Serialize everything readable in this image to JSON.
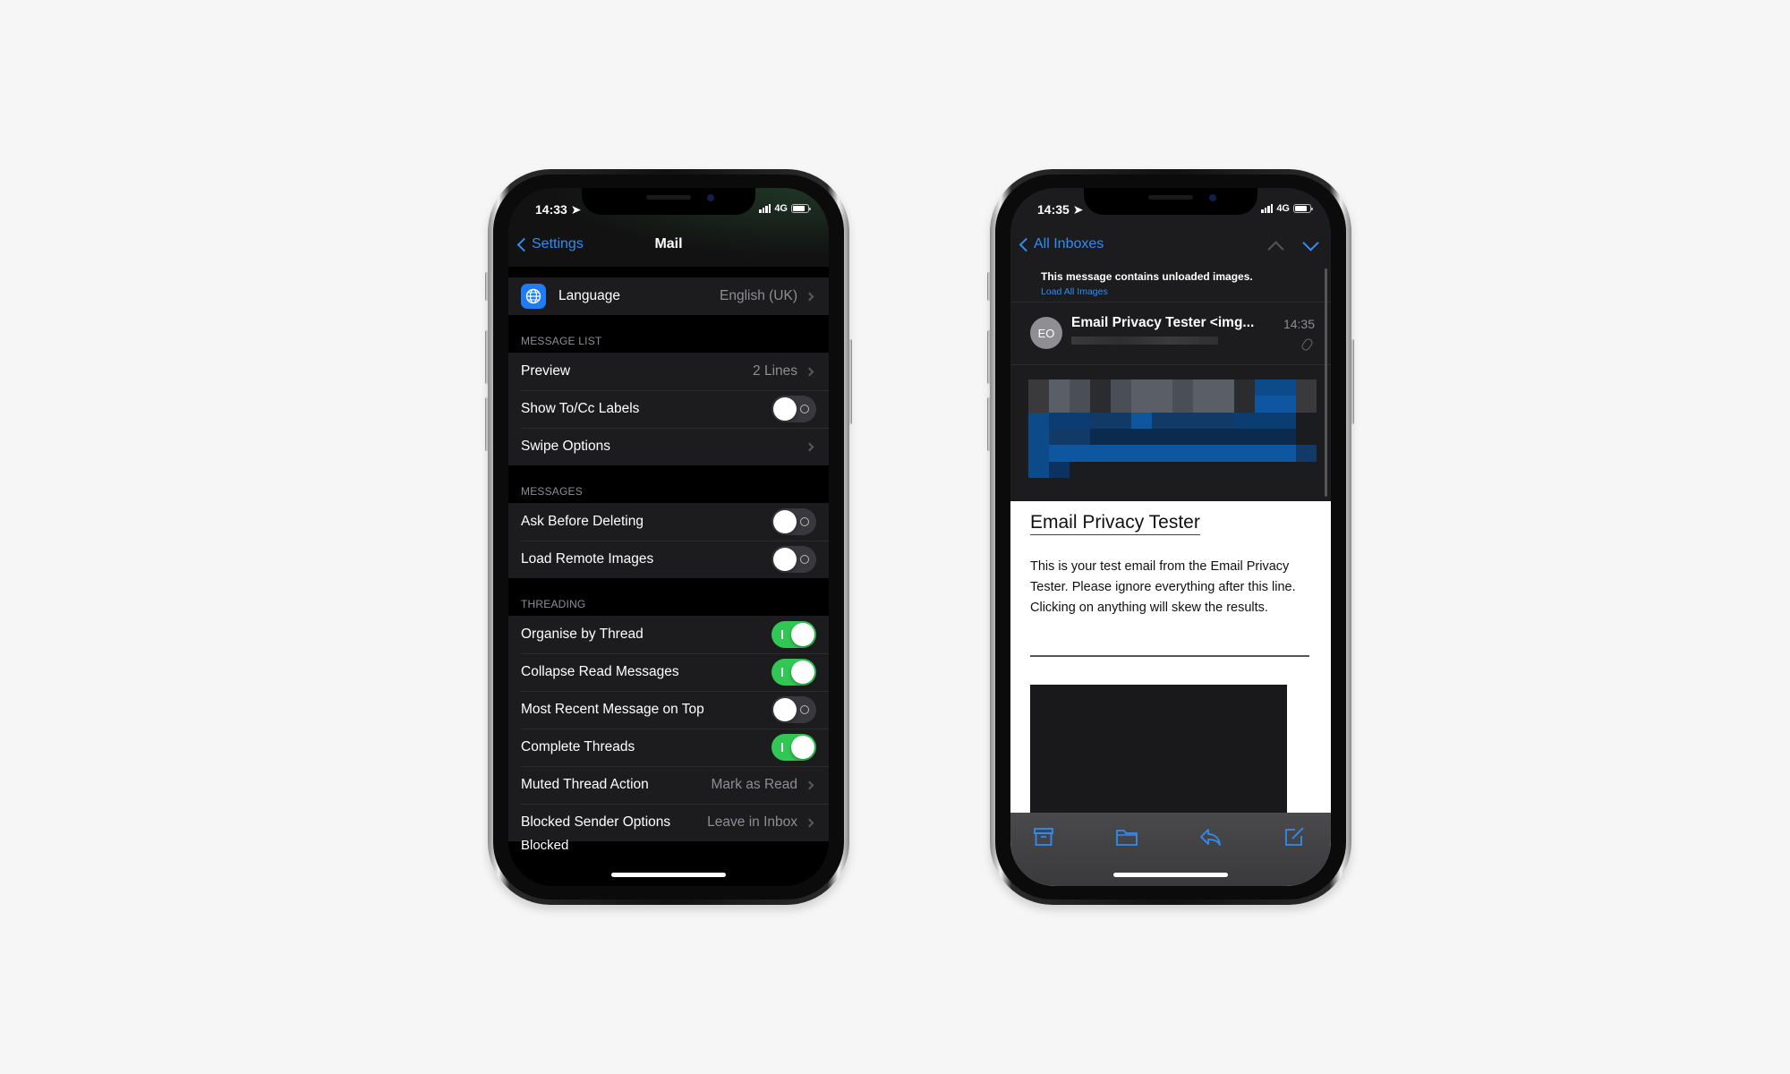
{
  "left_phone": {
    "status": {
      "time": "14:33",
      "network": "4G"
    },
    "nav": {
      "back_label": "Settings",
      "title": "Mail"
    },
    "language_row": {
      "label": "Language",
      "value": "English (UK)",
      "icon": "globe-icon"
    },
    "sections": [
      {
        "header": "MESSAGE LIST",
        "rows": [
          {
            "label": "Preview",
            "type": "link",
            "value": "2 Lines"
          },
          {
            "label": "Show To/Cc Labels",
            "type": "toggle",
            "on": false
          },
          {
            "label": "Swipe Options",
            "type": "link",
            "value": ""
          }
        ]
      },
      {
        "header": "MESSAGES",
        "rows": [
          {
            "label": "Ask Before Deleting",
            "type": "toggle",
            "on": false
          },
          {
            "label": "Load Remote Images",
            "type": "toggle",
            "on": false
          }
        ]
      },
      {
        "header": "THREADING",
        "rows": [
          {
            "label": "Organise by Thread",
            "type": "toggle",
            "on": true
          },
          {
            "label": "Collapse Read Messages",
            "type": "toggle",
            "on": true
          },
          {
            "label": "Most Recent Message on Top",
            "type": "toggle",
            "on": false
          },
          {
            "label": "Complete Threads",
            "type": "toggle",
            "on": true
          },
          {
            "label": "Muted Thread Action",
            "type": "link",
            "value": "Mark as Read"
          },
          {
            "label": "Blocked Sender Options",
            "type": "link",
            "value": "Leave in Inbox"
          }
        ]
      }
    ],
    "cut_off_row": "Blocked"
  },
  "right_phone": {
    "status": {
      "time": "14:35",
      "network": "4G"
    },
    "nav": {
      "back_label": "All Inboxes"
    },
    "banner": {
      "text": "This message contains unloaded images.",
      "link": "Load All Images"
    },
    "message": {
      "avatar_initials": "EO",
      "sender": "Email Privacy Tester <img...",
      "time": "14:35"
    },
    "html_body": {
      "title": "Email Privacy Tester",
      "text": "This is your test email from the Email Privacy Tester. Please ignore everything after this line. Clicking on anything will skew the results."
    },
    "toolbar": [
      "archive-icon",
      "folder-icon",
      "reply-icon",
      "compose-icon"
    ]
  },
  "colors": {
    "accent_blue": "#2f8df3",
    "toggle_on": "#31c754",
    "toggle_off": "#39393d",
    "background": "#f6f6f6"
  }
}
